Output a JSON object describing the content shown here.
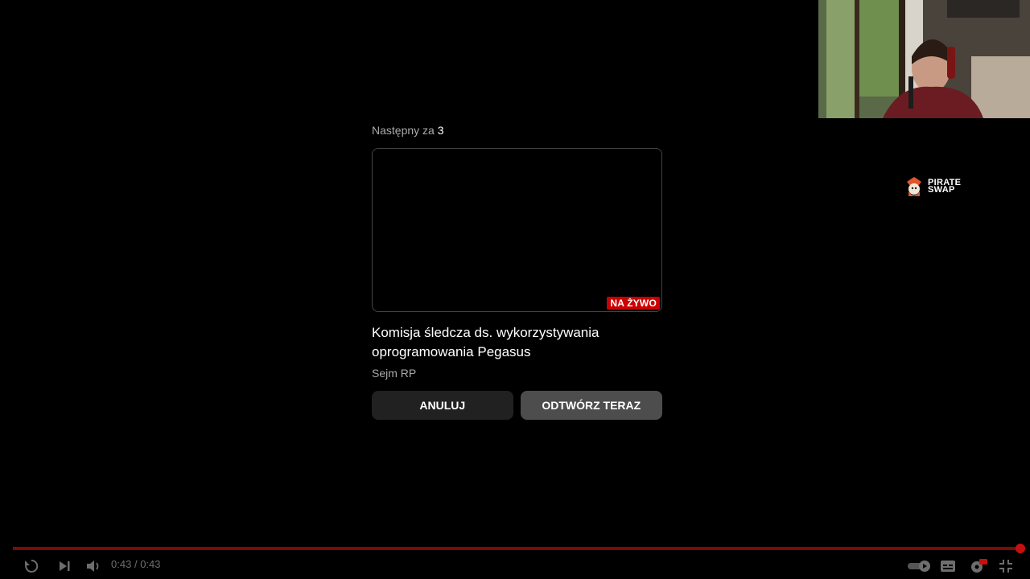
{
  "up_next": {
    "label": "Następny za",
    "countdown": "3",
    "live_badge": "NA ŻYWO",
    "title": "Komisja śledcza ds. wykorzystywania oprogramowania Pegasus",
    "channel": "Sejm RP"
  },
  "buttons": {
    "cancel": "ANULUJ",
    "play_now": "ODTWÓRZ TERAZ"
  },
  "sponsor": {
    "line1": "PIRATE",
    "line2": "SWAP"
  },
  "player": {
    "current_time": "0:43",
    "separator": "/",
    "duration": "0:43",
    "progress": 1.0,
    "icons": [
      "replay-icon",
      "next-icon",
      "volume-icon",
      "autoplay-toggle-icon",
      "subtitles-icon",
      "settings-icon",
      "exit-fullscreen-icon"
    ],
    "settings_badge": "HD"
  },
  "colors": {
    "background": "#000000",
    "live_badge": "#cc0000",
    "progress_fill": "#7d0a0a",
    "scrubber": "#c70f0f",
    "button_cancel": "#212121",
    "button_play": "#4d4d4d"
  }
}
